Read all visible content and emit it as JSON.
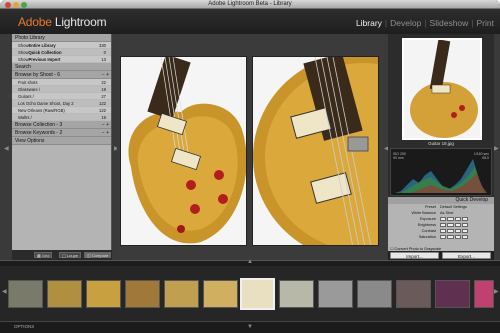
{
  "window": {
    "title": "Adobe Lightroom Beta - Library"
  },
  "logo": {
    "part1": "Adobe",
    "part2": "Lightroom"
  },
  "modules": [
    {
      "label": "Library",
      "active": true
    },
    {
      "label": "Develop",
      "active": false
    },
    {
      "label": "Slideshow",
      "active": false
    },
    {
      "label": "Print",
      "active": false
    }
  ],
  "left_panel": {
    "photo_library": {
      "title": "Photo Library",
      "rows": [
        {
          "prefix": "Show",
          "label": "Entire Library",
          "count": "330"
        },
        {
          "prefix": "Show",
          "label": "Quick Collection",
          "count": "0"
        },
        {
          "prefix": "Show",
          "label": "Previous Import",
          "count": "13"
        }
      ]
    },
    "search": {
      "title": "Search"
    },
    "browse_by_shoot": {
      "title": "Browse by Shoot - 6",
      "rows": [
        {
          "label": "Fruit shots",
          "count": "22"
        },
        {
          "label": "Glassware /",
          "count": "19"
        },
        {
          "label": "Guitars /",
          "count": "27"
        },
        {
          "label": "Los Ocho Dame Shoot, Day 2",
          "count": "122"
        },
        {
          "label": "New Orleans (Raw/RGB)",
          "count": "122"
        },
        {
          "label": "Wallrs /",
          "count": "19"
        }
      ]
    },
    "browse_collections": {
      "title": "Browse Collection - 3"
    },
    "browse_keywords": {
      "title": "Browse Keywords - 2"
    },
    "view_options": {
      "title": "View Options"
    },
    "toolbar": {
      "grid": "Grid",
      "loupe": "Loupe",
      "compare": "Compare"
    }
  },
  "right_panel": {
    "thumb_label": "Guitar 18.jpg",
    "histogram": {
      "left_line1": "ISO 200",
      "left_line2": "90 mm",
      "right_line1": "1/160 sec",
      "right_line2": "f/8.0"
    },
    "quick_develop": {
      "title": "Quick Develop",
      "preset_label": "Preset",
      "preset_value": "Default Settings",
      "wb_label": "White Balance",
      "wb_value": "As Shot",
      "controls": [
        "Exposure",
        "Brightness",
        "Contrast",
        "Saturation"
      ],
      "grayscale": "Convert Photo to Grayscale",
      "copy": "Copy Settings",
      "paste": "Paste Settings"
    },
    "actions": {
      "import": "Import...",
      "export": "Export..."
    }
  },
  "bottom": {
    "options": "OPTIONS"
  },
  "colors": {
    "accent": "#e87a2d",
    "panel": "#b4b4b4",
    "dark": "#2c2c2c"
  }
}
